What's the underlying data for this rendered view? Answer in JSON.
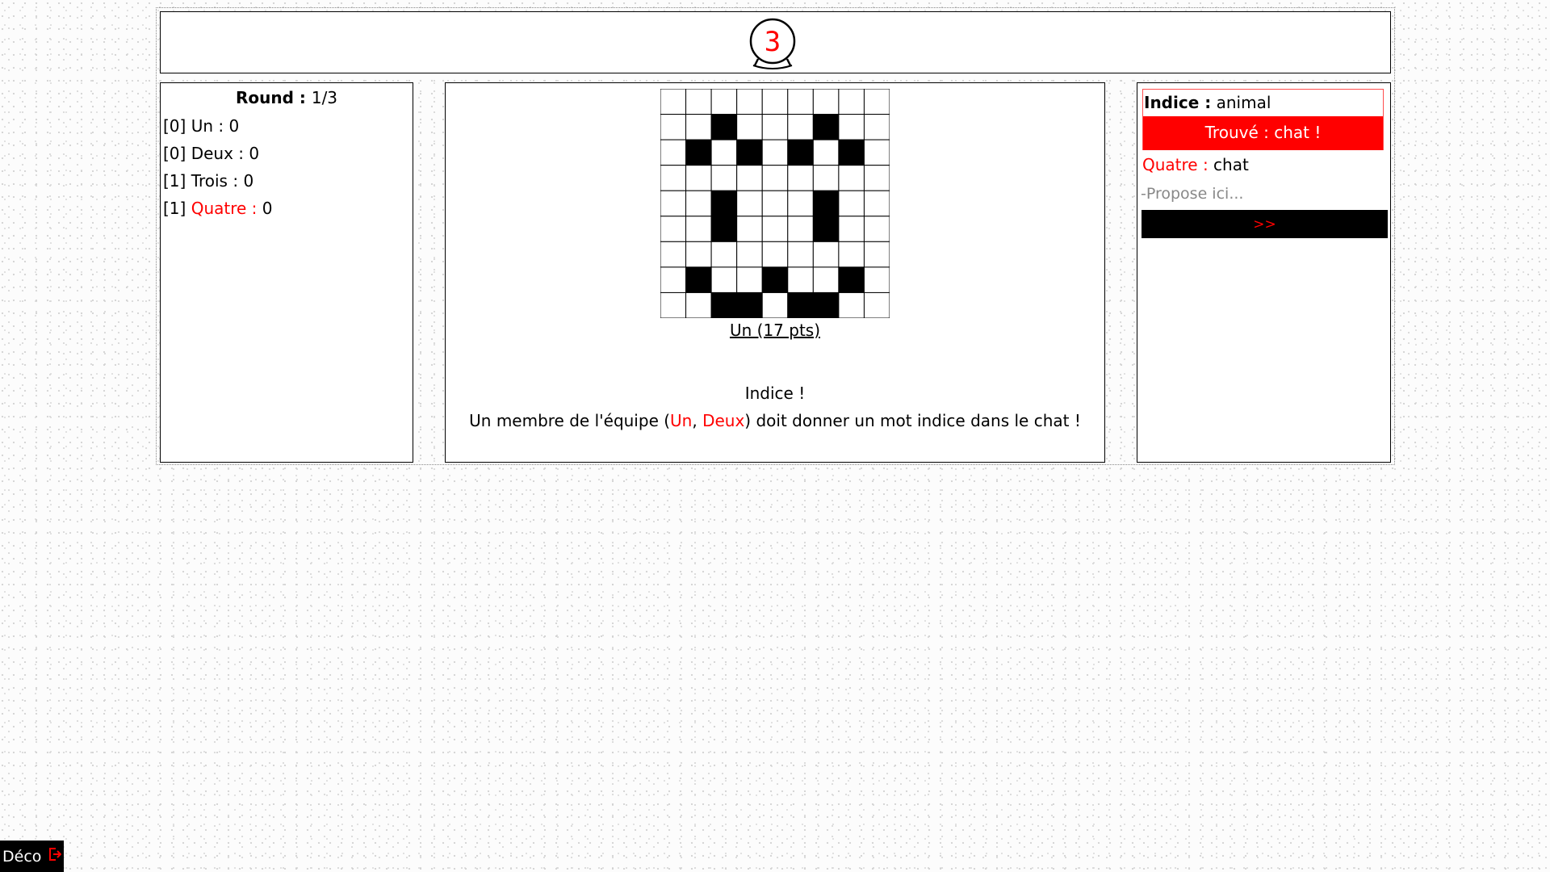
{
  "timer": {
    "value": "3",
    "color": "#ff0000"
  },
  "scoreboard": {
    "round_label": "Round",
    "round_sep": " : ",
    "round_value": "1/3",
    "players": [
      {
        "team": "[0]",
        "name": "Un",
        "score": "0",
        "highlight": false
      },
      {
        "team": "[0]",
        "name": "Deux",
        "score": "0",
        "highlight": false
      },
      {
        "team": "[1]",
        "name": "Trois",
        "score": "0",
        "highlight": false
      },
      {
        "team": "[1]",
        "name": "Quatre",
        "score": "0",
        "highlight": true
      }
    ]
  },
  "drawing": {
    "rows": 9,
    "cols": 9,
    "filled_cells": [
      [
        1,
        2
      ],
      [
        1,
        6
      ],
      [
        2,
        1
      ],
      [
        2,
        3
      ],
      [
        2,
        5
      ],
      [
        2,
        7
      ],
      [
        4,
        2
      ],
      [
        4,
        6
      ],
      [
        5,
        2
      ],
      [
        5,
        6
      ],
      [
        7,
        1
      ],
      [
        7,
        4
      ],
      [
        7,
        7
      ],
      [
        8,
        2
      ],
      [
        8,
        3
      ],
      [
        8,
        5
      ],
      [
        8,
        6
      ]
    ],
    "artist": "Un (17 pts)"
  },
  "hint": {
    "title": "Indice !",
    "text_before": "Un membre de l'équipe (",
    "team_member_1": "Un",
    "separator": ", ",
    "team_member_2": "Deux",
    "text_after": ") doit donner un mot indice dans le chat !"
  },
  "chat": {
    "clue_label": "Indice :",
    "clue_value": " animal",
    "found_banner": "Trouvé : chat !",
    "message_author": "Quatre :",
    "message_text": " chat",
    "input_placeholder": "-Propose ici...",
    "send_label": ">>"
  },
  "logout": {
    "label": "Déco",
    "icon": "logout-icon"
  },
  "colors": {
    "accent": "#ff0000",
    "dark": "#000000"
  }
}
